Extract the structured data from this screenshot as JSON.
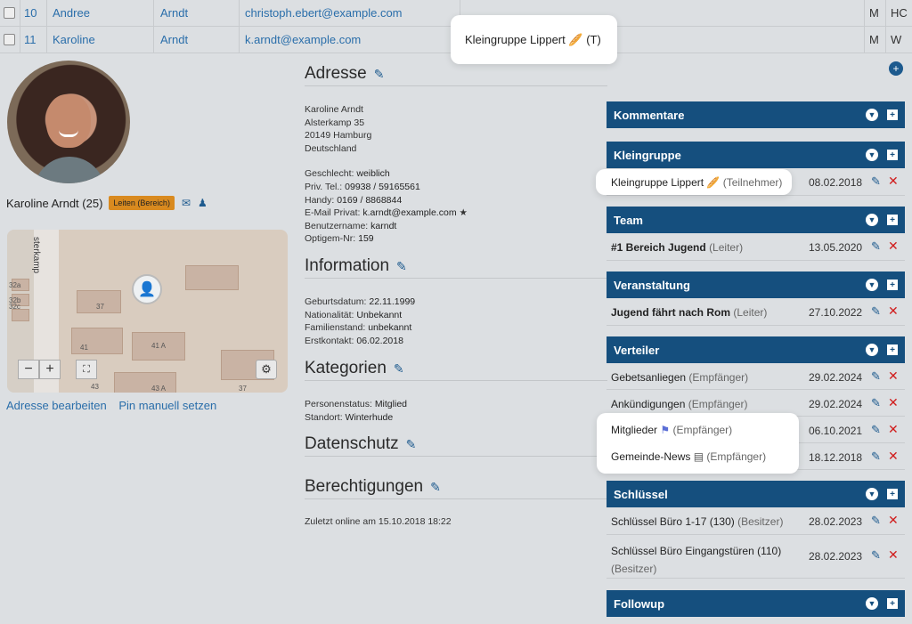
{
  "table_rows": [
    {
      "num": "10",
      "first": "Andree",
      "last": "Arndt",
      "email": "christoph.ebert@example.com",
      "group": "",
      "sex": "M",
      "extra": "HC"
    },
    {
      "num": "11",
      "first": "Karoline",
      "last": "Arndt",
      "email": "k.arndt@example.com",
      "group": "Kleingruppe Lippert",
      "group_suffix": "(T)",
      "sex": "M",
      "extra": "W"
    }
  ],
  "profile": {
    "name_age": "Karoline Arndt (25)",
    "badge": "Leiten (Bereich)",
    "map_street": "sterkamp",
    "map_numbers": [
      "32a",
      "32b",
      "32c",
      "37",
      "41",
      "41 A",
      "43",
      "43 A",
      "37"
    ],
    "link_edit_address": "Adresse bearbeiten",
    "link_set_pin": "Pin manuell setzen"
  },
  "address": {
    "title": "Adresse",
    "lines": [
      "Karoline Arndt",
      "Alsterkamp 35",
      "20149 Hamburg",
      "Deutschland"
    ],
    "gender_label": "Geschlecht:",
    "gender": "weiblich",
    "phone_label": "Priv. Tel.:",
    "phone": "09938 / 59165561",
    "mobile_label": "Handy:",
    "mobile": "0169 / 8868844",
    "email_label": "E-Mail Privat:",
    "email": "k.arndt@example.com",
    "user_label": "Benutzername:",
    "user": "karndt",
    "optigem_label": "Optigem-Nr:",
    "optigem": "159"
  },
  "information": {
    "title": "Information",
    "birth_label": "Geburtsdatum:",
    "birth": "22.11.1999",
    "nation_label": "Nationalität:",
    "nation": "Unbekannt",
    "family_label": "Familienstand:",
    "family": "unbekannt",
    "first_label": "Erstkontakt:",
    "first": "06.02.2018"
  },
  "categories": {
    "title": "Kategorien",
    "status_label": "Personenstatus:",
    "status": "Mitglied",
    "site_label": "Standort:",
    "site": "Winterhude"
  },
  "privacy": {
    "title": "Datenschutz"
  },
  "permissions": {
    "title": "Berechtigungen",
    "last_online": "Zuletzt online am 15.10.2018 18:22"
  },
  "panels": {
    "kommentare": "Kommentare",
    "kleingruppe": "Kleingruppe",
    "team": "Team",
    "veranstaltung": "Veranstaltung",
    "verteiler": "Verteiler",
    "schluessel": "Schlüssel",
    "followup": "Followup"
  },
  "entries": {
    "kg1": {
      "name": "Kleingruppe Lippert",
      "role": "(Teilnehmer)",
      "date": "08.02.2018"
    },
    "team1": {
      "name": "#1 Bereich Jugend",
      "role": "(Leiter)",
      "date": "13.05.2020"
    },
    "ev1": {
      "name": "Jugend fährt nach Rom",
      "role": "(Leiter)",
      "date": "27.10.2022"
    },
    "v1": {
      "name": "Gebetsanliegen",
      "role": "(Empfänger)",
      "date": "29.02.2024"
    },
    "v2": {
      "name": "Ankündigungen",
      "role": "(Empfänger)",
      "date": "29.02.2024"
    },
    "v3": {
      "name": "Mitglieder",
      "role": "(Empfänger)",
      "date": "06.10.2021"
    },
    "v4": {
      "name": "Gemeinde-News",
      "role": "(Empfänger)",
      "date": "18.12.2018"
    },
    "k1": {
      "name": "Schlüssel Büro 1-17 (130)",
      "role": "(Besitzer)",
      "date": "28.02.2023"
    },
    "k2": {
      "name": "Schlüssel Büro Eingangstüren (110)",
      "role": "(Besitzer)",
      "date": "28.02.2023"
    }
  },
  "colors": {
    "panel_header": "#154f7e",
    "link": "#2a6eaa",
    "badge": "#d98a1f",
    "delete": "#d01c1c"
  }
}
